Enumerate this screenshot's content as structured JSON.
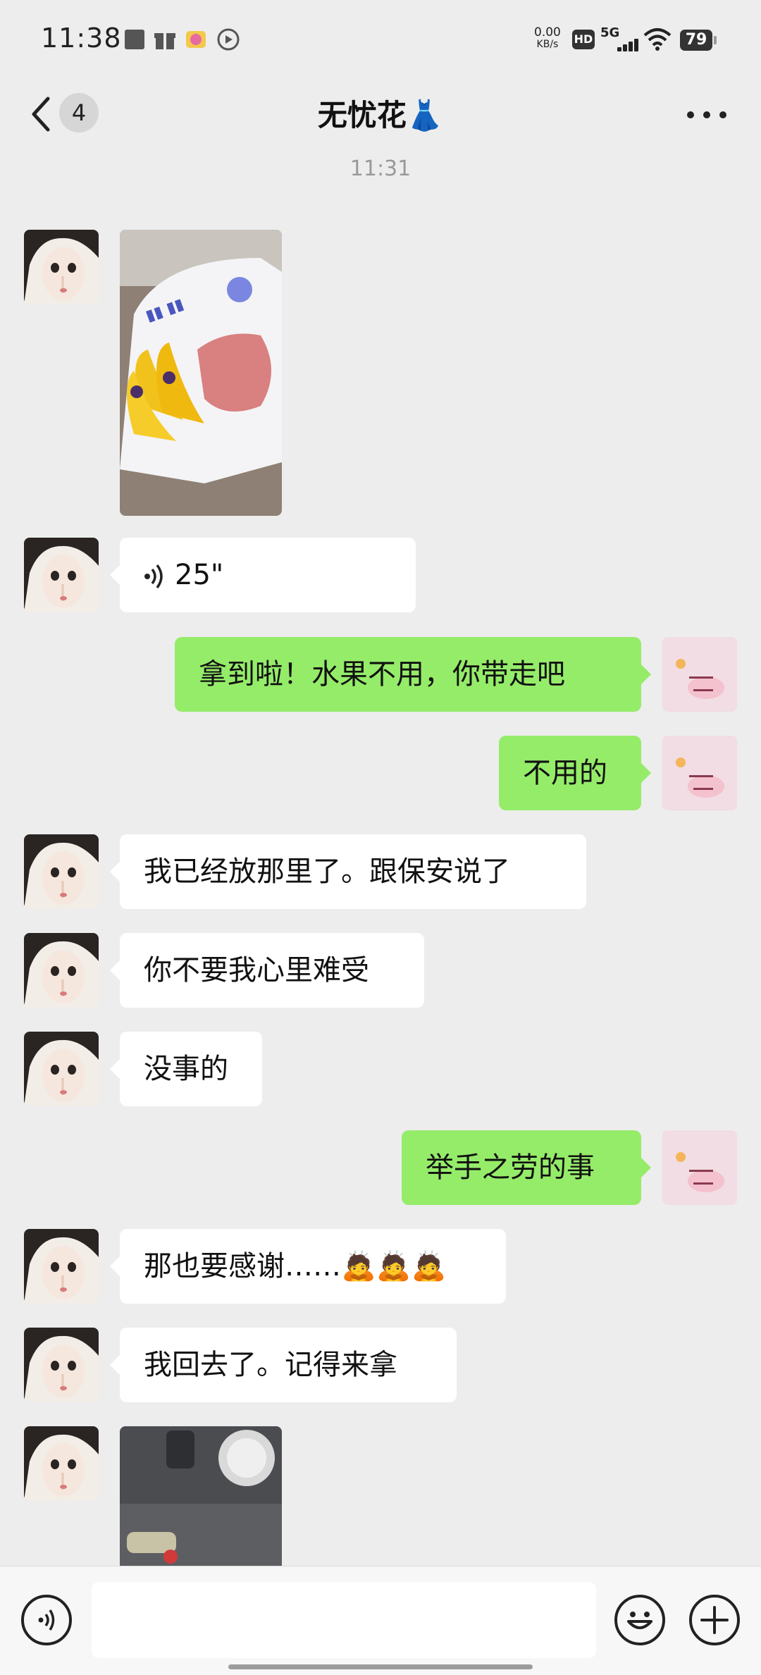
{
  "status_bar": {
    "time": "11:38",
    "speed_value": "0.00",
    "speed_unit": "KB/s",
    "hd": "HD",
    "network": "5G",
    "battery": "79",
    "icons": [
      "stop-icon",
      "gift-icon",
      "cake-icon",
      "play-icon",
      "signal-icon",
      "wifi-icon"
    ]
  },
  "nav": {
    "unread_count": "4",
    "title": "无忧花👗",
    "back_icon": "back-chevron-icon",
    "more_icon": "more-dots-icon"
  },
  "chat": {
    "timestamp": "11:31",
    "messages": [
      {
        "side": "in",
        "type": "image",
        "subject": "bananas in plastic bag"
      },
      {
        "side": "in",
        "type": "voice",
        "duration": "25\""
      },
      {
        "side": "out",
        "type": "text",
        "text": "拿到啦！水果不用，你带走吧"
      },
      {
        "side": "out",
        "type": "text",
        "text": "不用的"
      },
      {
        "side": "in",
        "type": "text",
        "text": "我已经放那里了。跟保安说了"
      },
      {
        "side": "in",
        "type": "text",
        "text": "你不要我心里难受"
      },
      {
        "side": "in",
        "type": "text",
        "text": "没事的"
      },
      {
        "side": "out",
        "type": "text",
        "text": "举手之劳的事"
      },
      {
        "side": "in",
        "type": "text",
        "text": "那也要感谢……🙇🙇🙇"
      },
      {
        "side": "in",
        "type": "text",
        "text": "我回去了。记得来拿"
      },
      {
        "side": "in",
        "type": "image",
        "subject": "car keys near console"
      }
    ]
  },
  "input_bar": {
    "voice_icon": "voice-mode-icon",
    "emoji_icon": "emoji-icon",
    "add_icon": "plus-icon",
    "placeholder": ""
  },
  "colors": {
    "background": "#EDEDED",
    "outgoing_bubble": "#95EC69",
    "incoming_bubble": "#FFFFFF"
  }
}
